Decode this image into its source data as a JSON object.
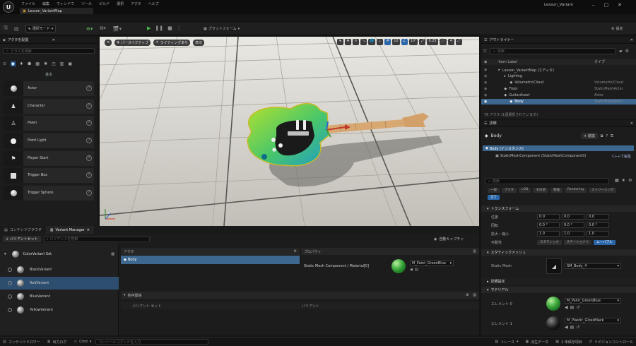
{
  "titlebar": {
    "menu": [
      "ファイル",
      "編集",
      "ウィンドウ",
      "ツール",
      "ビルド",
      "選択",
      "アクタ",
      "ヘルプ"
    ],
    "doc_tab": "Lesson_VariantMap",
    "project": "Lesson_Variant"
  },
  "toolbar": {
    "mode": "選択モード",
    "platform": "プラットフォーム",
    "settings": "設定"
  },
  "place_actors": {
    "title": "アクタを配置",
    "search_placeholder": "クラスを検索",
    "category": "基本",
    "items": [
      {
        "label": "Actor"
      },
      {
        "label": "Character"
      },
      {
        "label": "Pawn"
      },
      {
        "label": "Point Light"
      },
      {
        "label": "Player Start"
      },
      {
        "label": "Trigger Box"
      },
      {
        "label": "Trigger Sphere"
      }
    ]
  },
  "viewport": {
    "perspective": "パースペクティブ",
    "lighting": "ライティングあり",
    "show": "表示",
    "grid_snap": "10",
    "rot_snap": "10°",
    "scale_snap": "0.25",
    "cam_speed": "4"
  },
  "outliner": {
    "title": "アウトライナー",
    "search_placeholder": "検索",
    "col_label": "Item Label",
    "col_type": "タイプ",
    "rows": [
      {
        "label": "Lesson_VariantMap (エディタ)",
        "type": "",
        "indent": 1,
        "selected": false
      },
      {
        "label": "Lighting",
        "type": "",
        "indent": 2,
        "selected": false
      },
      {
        "label": "VolumetricCloud",
        "type": "VolumetricCloud",
        "indent": 3,
        "selected": false
      },
      {
        "label": "Floor",
        "type": "StaticMeshActor",
        "indent": 2,
        "selected": false
      },
      {
        "label": "GuitarAsset",
        "type": "Actor",
        "indent": 2,
        "selected": false
      },
      {
        "label": "Body",
        "type": "StaticMeshActor",
        "indent": 3,
        "selected": true
      }
    ],
    "count": "76 アクタ (1個選択されています)"
  },
  "details": {
    "title": "詳細",
    "actor": "Body",
    "add_label": "+ 追加",
    "instance": "Body (インスタンス)",
    "component": "StaticMeshComponent (StaticMeshComponent0)",
    "edit_cpp": "C++で編集",
    "search_placeholder": "検索",
    "filters": [
      "一般",
      "アクタ",
      "LOD",
      "その他",
      "物理",
      "Rendering",
      "ストリーミング",
      "全て"
    ],
    "transform": {
      "title": "トランスフォーム",
      "location_label": "位置",
      "rotation_label": "回転",
      "scale_label": "拡大・縮小",
      "location": [
        "0.0",
        "0.0",
        "0.0"
      ],
      "rotation": [
        "0.0 °",
        "0.0 °",
        "0.0 °"
      ],
      "scale": [
        "1.0",
        "1.0",
        "1.0"
      ],
      "mobility_label": "可動性",
      "mobility": [
        "スタティック",
        "ステーショナリ",
        "ムーバブル"
      ]
    },
    "static_mesh": {
      "title": "スタティックメッシュ",
      "label": "Static Mesh",
      "value": "SM_Body_4"
    },
    "advanced": "詳細設定",
    "materials": {
      "title": "マテリアル",
      "elements": [
        {
          "label": "エレメント 0",
          "value": "M_Paint_GreenBlue"
        },
        {
          "label": "エレメント 1",
          "value": "M_Plastic_GlossBlack"
        }
      ]
    }
  },
  "bottom_tabs": {
    "content_browser": "コンテンツブラウザ",
    "variant_manager": "Variant Manager"
  },
  "variant_manager": {
    "add_variant_set": "+ バリアントセット",
    "search_placeholder": "バリアントを検索",
    "capture": "自動キャプチャ",
    "variant_set": "ColorVariant Set",
    "variants": [
      {
        "label": "BlackVariant",
        "selected": false
      },
      {
        "label": "RedVariant",
        "selected": true
      },
      {
        "label": "BlueVariant",
        "selected": false
      },
      {
        "label": "YellowVariant",
        "selected": false
      }
    ],
    "actors_header": "アクタ",
    "actor_row": "Body",
    "props_header": "プロパティ",
    "prop_row": "Static Mesh Component / Material[0]",
    "prop_value": "M_Paint_GreenBlue",
    "dependencies": "依存関係",
    "dep_col1": "バリアント セット",
    "dep_col2": "バリアント"
  },
  "statusbar": {
    "content_drawer": "コンテンツドロワー",
    "output_log": "出力ログ",
    "cmd": "Cmd",
    "console_placeholder": "コンソールコマンドを入力",
    "trace": "トレース",
    "derived": "派生データ",
    "unsaved": "2 未保存項目",
    "source_control": "リビジョンコントロール"
  },
  "colors": {
    "accent": "#2b67a8",
    "play": "#4bbe48",
    "selection": "#3e6790"
  }
}
